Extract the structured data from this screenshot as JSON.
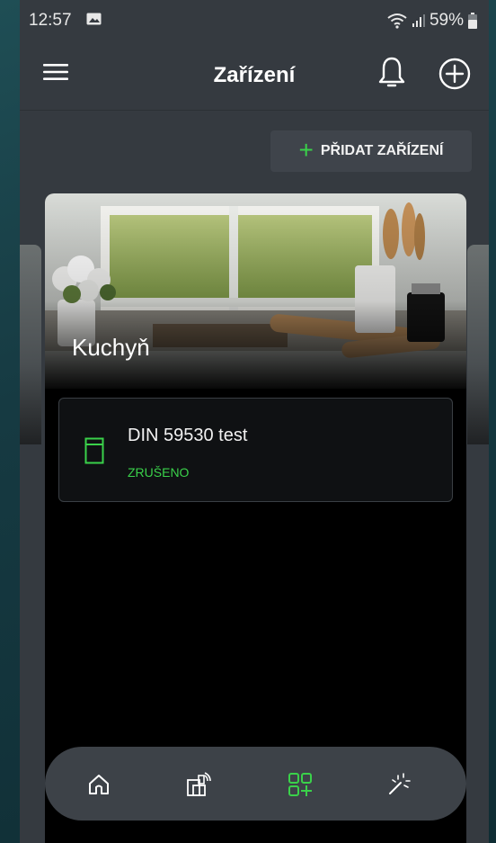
{
  "status_bar": {
    "time": "12:57",
    "battery": "59%"
  },
  "app_bar": {
    "title": "Zařízení"
  },
  "actions": {
    "add_device_label": "PŘIDAT ZAŘÍZENÍ"
  },
  "room": {
    "name": "Kuchyň",
    "devices": [
      {
        "name": "DIN 59530 test",
        "status": "ZRUŠENO"
      }
    ]
  },
  "bottom_nav": {
    "items": [
      "home-icon",
      "devices-icon",
      "add-group-icon",
      "magic-wand-icon"
    ],
    "active_index": 2
  },
  "colors": {
    "accent": "#3ad14a",
    "background": "#353a40",
    "nav": "#3d4248"
  }
}
